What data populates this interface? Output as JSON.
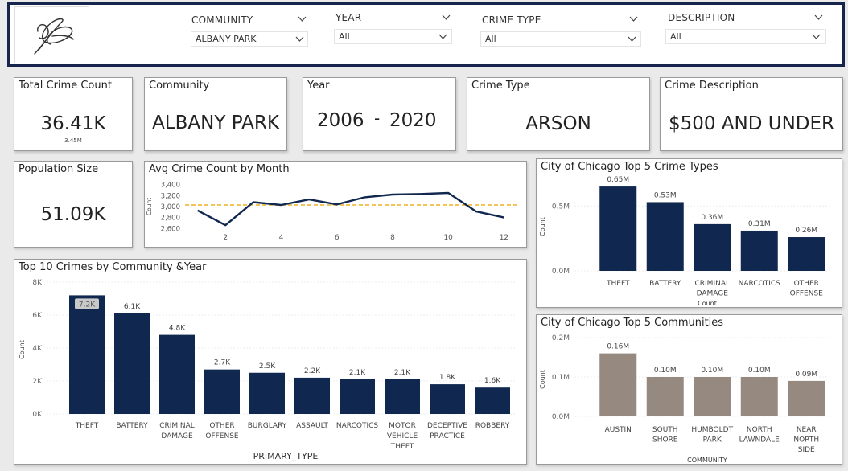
{
  "filters": [
    {
      "label": "COMMUNITY",
      "value": "ALBANY PARK"
    },
    {
      "label": "YEAR",
      "value": "All"
    },
    {
      "label": "CRIME TYPE",
      "value": "All"
    },
    {
      "label": "DESCRIPTION",
      "value": "All"
    }
  ],
  "kpis": {
    "total": {
      "title": "Total Crime Count",
      "value": "36.41K",
      "sub": "3.45M"
    },
    "community": {
      "title": "Community",
      "value": "ALBANY PARK"
    },
    "year": {
      "title": "Year",
      "from": "2006",
      "dash": "-",
      "to": "2020"
    },
    "crime_type": {
      "title": "Crime Type",
      "value": "ARSON"
    },
    "description": {
      "title": "Crime Description",
      "value": "$500 AND UNDER"
    },
    "population": {
      "title": "Population Size",
      "value": "51.09K"
    }
  },
  "chart_data": [
    {
      "id": "avg_month",
      "type": "line",
      "title": "Avg Crime Count by Month",
      "ylabel": "Count",
      "xlabel": "",
      "x": [
        1,
        2,
        3,
        4,
        5,
        6,
        7,
        8,
        9,
        10,
        11,
        12
      ],
      "xticks": [
        "2",
        "4",
        "6",
        "8",
        "10",
        "12"
      ],
      "xtick_values": [
        2,
        4,
        6,
        8,
        10,
        12
      ],
      "y": [
        2930,
        2660,
        3080,
        3030,
        3130,
        3040,
        3170,
        3220,
        3230,
        3250,
        2910,
        2800
      ],
      "yticks": [
        "3,400",
        "3,200",
        "3,000",
        "2,800",
        "2,600"
      ],
      "ytick_values": [
        3400,
        3200,
        3000,
        2800,
        2600
      ],
      "ylim": [
        2560,
        3440
      ],
      "reference_line": 3030,
      "colors": {
        "line": "#10284f",
        "ref": "#f2c45a"
      }
    },
    {
      "id": "top10",
      "type": "bar",
      "title": "Top 10 Crimes by Community &Year",
      "xlabel": "PRIMARY_TYPE",
      "ylabel": "Count",
      "categories": [
        [
          "THEFT"
        ],
        [
          "BATTERY"
        ],
        [
          "CRIMINAL",
          "DAMAGE"
        ],
        [
          "OTHER",
          "OFFENSE"
        ],
        [
          "BURGLARY"
        ],
        [
          "ASSAULT"
        ],
        [
          "NARCOTICS"
        ],
        [
          "MOTOR",
          "VEHICLE",
          "THEFT"
        ],
        [
          "DECEPTIVE",
          "PRACTICE"
        ],
        [
          "ROBBERY"
        ]
      ],
      "values": [
        7200,
        6100,
        4800,
        2700,
        2500,
        2200,
        2100,
        2100,
        1800,
        1600
      ],
      "labels": [
        "7.2K",
        "6.1K",
        "4.8K",
        "2.7K",
        "2.5K",
        "2.2K",
        "2.1K",
        "2.1K",
        "1.8K",
        "1.6K"
      ],
      "yticks": [
        "8K",
        "6K",
        "4K",
        "2K",
        "0K"
      ],
      "ytick_values": [
        8000,
        6000,
        4000,
        2000,
        0
      ],
      "ylim": [
        0,
        8000
      ],
      "colors": {
        "bar": "#10284f"
      }
    },
    {
      "id": "top5types",
      "type": "bar",
      "title": "City of Chicago Top 5 Crime Types",
      "xlabel": "Count",
      "ylabel": "Count",
      "categories": [
        [
          "THEFT"
        ],
        [
          "BATTERY"
        ],
        [
          "CRIMINAL",
          "DAMAGE"
        ],
        [
          "NARCOTICS"
        ],
        [
          "OTHER",
          "OFFENSE"
        ]
      ],
      "values": [
        0.65,
        0.53,
        0.36,
        0.31,
        0.26
      ],
      "labels": [
        "0.65M",
        "0.53M",
        "0.36M",
        "0.31M",
        "0.26M"
      ],
      "yticks": [
        "0.5M",
        "0.0M"
      ],
      "ytick_values": [
        0.5,
        0
      ],
      "ylim": [
        0,
        0.7
      ],
      "colors": {
        "bar": "#10284f"
      }
    },
    {
      "id": "top5comm",
      "type": "bar",
      "title": "City of Chicago Top 5 Communities",
      "xlabel": "COMMUNITY",
      "ylabel": "Count",
      "categories": [
        [
          "AUSTIN"
        ],
        [
          "SOUTH",
          "SHORE"
        ],
        [
          "HUMBOLDT",
          "PARK"
        ],
        [
          "NORTH",
          "LAWNDALE"
        ],
        [
          "NEAR",
          "NORTH",
          "SIDE"
        ]
      ],
      "values": [
        0.16,
        0.1,
        0.1,
        0.1,
        0.09
      ],
      "labels": [
        "0.16M",
        "0.10M",
        "0.10M",
        "0.10M",
        "0.09M"
      ],
      "yticks": [
        "0.2M",
        "0.1M",
        "0.0M"
      ],
      "ytick_values": [
        0.2,
        0.1,
        0
      ],
      "ylim": [
        0,
        0.2
      ],
      "colors": {
        "bar": "#968a80"
      }
    }
  ]
}
